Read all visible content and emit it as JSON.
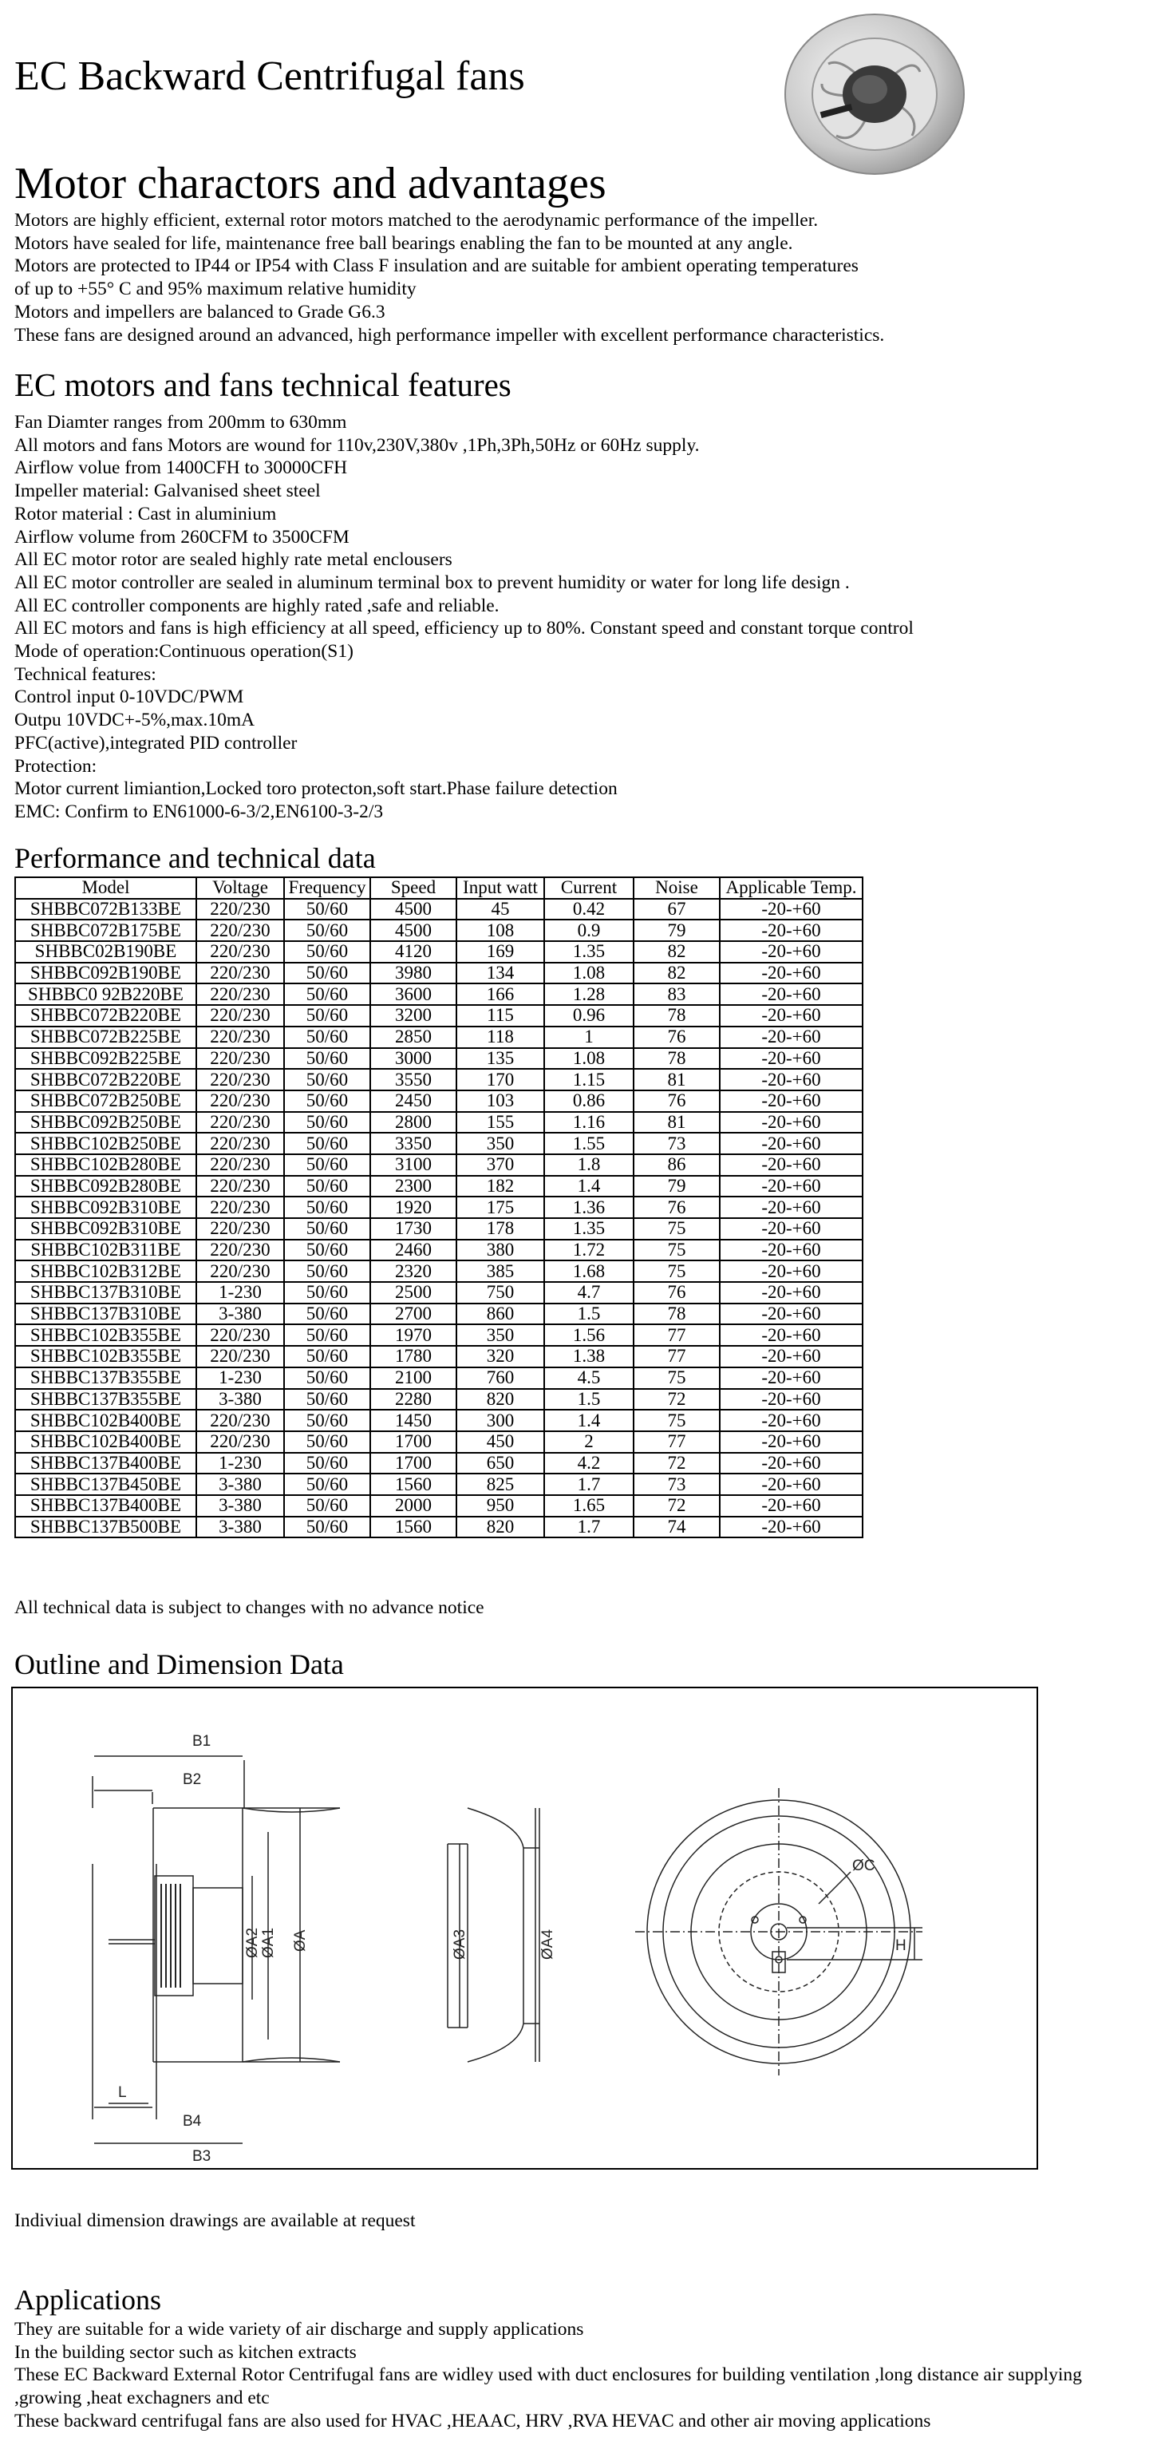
{
  "title": "EC  Backward Centrifugal fans",
  "motor_section": {
    "heading": "Motor charactors and advantages",
    "lines": [
      " Motors are highly efficient, external rotor motors matched to the aerodynamic performance of the impeller.",
      "Motors have sealed for life, maintenance free ball bearings enabling the fan to be mounted at any angle.",
      "Motors are protected to IP44 or IP54 with Class F insulation and are suitable for ambient operating temperatures",
      "of up to +55° C and 95% maximum relative humidity",
      "Motors and impellers are balanced to Grade G6.3",
      "These fans are designed around an advanced, high performance impeller with excellent performance characteristics."
    ]
  },
  "features_section": {
    "heading": "EC motors and fans technical features",
    "lines": [
      "Fan Diamter ranges from  200mm to 630mm",
      "All motors and fans Motors are wound for 110v,230V,380v ,1Ph,3Ph,50Hz or 60Hz supply.",
      "Airflow volue from 1400CFH to 30000CFH",
      "Impeller material: Galvanised sheet steel",
      "Rotor material : Cast in aluminium",
      "Airflow volume from 260CFM to 3500CFM",
      "All EC motor rotor are sealed highly rate metal enclousers",
      "All EC motor controller are sealed in aluminum terminal box to prevent humidity or water for long life design .",
      "All EC controller components are highly rated ,safe and reliable.",
      "All EC motors and fans is high efficiency at all speed, efficiency up to 80%. Constant speed and constant torque control",
      "Mode of operation:Continuous operation(S1)",
      "Technical features:",
      "Control input 0-10VDC/PWM",
      "Outpu 10VDC+-5%,max.10mA",
      "PFC(active),integrated PID controller",
      "Protection:",
      "Motor current limiantion,Locked toro protecton,soft start.Phase failure detection",
      "EMC: Confirm to EN61000-6-3/2,EN6100-3-2/3"
    ]
  },
  "performance": {
    "heading": "Performance and technical data",
    "columns": [
      "Model",
      "Voltage",
      "Frequency",
      "Speed",
      "Input watt",
      "Current",
      "Noise",
      "Applicable Temp."
    ],
    "rows": [
      [
        "SHBBC072B133BE",
        "220/230",
        "50/60",
        "4500",
        "45",
        "0.42",
        "67",
        "-20-+60"
      ],
      [
        "SHBBC072B175BE",
        "220/230",
        "50/60",
        "4500",
        "108",
        "0.9",
        "79",
        "-20-+60"
      ],
      [
        "SHBBC02B190BE",
        "220/230",
        "50/60",
        "4120",
        "169",
        "1.35",
        "82",
        "-20-+60"
      ],
      [
        "SHBBC092B190BE",
        "220/230",
        "50/60",
        "3980",
        "134",
        "1.08",
        "82",
        "-20-+60"
      ],
      [
        "SHBBC0 92B220BE",
        "220/230",
        "50/60",
        "3600",
        "166",
        "1.28",
        "83",
        "-20-+60"
      ],
      [
        "SHBBC072B220BE",
        "220/230",
        "50/60",
        "3200",
        "115",
        "0.96",
        "78",
        "-20-+60"
      ],
      [
        "SHBBC072B225BE",
        "220/230",
        "50/60",
        "2850",
        "118",
        "1",
        "76",
        "-20-+60"
      ],
      [
        "SHBBC092B225BE",
        "220/230",
        "50/60",
        "3000",
        "135",
        "1.08",
        "78",
        "-20-+60"
      ],
      [
        "SHBBC072B220BE",
        "220/230",
        "50/60",
        "3550",
        "170",
        "1.15",
        "81",
        "-20-+60"
      ],
      [
        "SHBBC072B250BE",
        "220/230",
        "50/60",
        "2450",
        "103",
        "0.86",
        "76",
        "-20-+60"
      ],
      [
        "SHBBC092B250BE",
        "220/230",
        "50/60",
        "2800",
        "155",
        "1.16",
        "81",
        "-20-+60"
      ],
      [
        "SHBBC102B250BE",
        "220/230",
        "50/60",
        "3350",
        "350",
        "1.55",
        "73",
        "-20-+60"
      ],
      [
        "SHBBC102B280BE",
        "220/230",
        "50/60",
        "3100",
        "370",
        "1.8",
        "86",
        "-20-+60"
      ],
      [
        "SHBBC092B280BE",
        "220/230",
        "50/60",
        "2300",
        "182",
        "1.4",
        "79",
        "-20-+60"
      ],
      [
        "SHBBC092B310BE",
        "220/230",
        "50/60",
        "1920",
        "175",
        "1.36",
        "76",
        "-20-+60"
      ],
      [
        "SHBBC092B310BE",
        "220/230",
        "50/60",
        "1730",
        "178",
        "1.35",
        "75",
        "-20-+60"
      ],
      [
        "SHBBC102B311BE",
        "220/230",
        "50/60",
        "2460",
        "380",
        "1.72",
        "75",
        "-20-+60"
      ],
      [
        "SHBBC102B312BE",
        "220/230",
        "50/60",
        "2320",
        "385",
        "1.68",
        "75",
        "-20-+60"
      ],
      [
        "SHBBC137B310BE",
        "1-230",
        "50/60",
        "2500",
        "750",
        "4.7",
        "76",
        "-20-+60"
      ],
      [
        "SHBBC137B310BE",
        "3-380",
        "50/60",
        "2700",
        "860",
        "1.5",
        "78",
        "-20-+60"
      ],
      [
        "SHBBC102B355BE",
        "220/230",
        "50/60",
        "1970",
        "350",
        "1.56",
        "77",
        "-20-+60"
      ],
      [
        "SHBBC102B355BE",
        "220/230",
        "50/60",
        "1780",
        "320",
        "1.38",
        "77",
        "-20-+60"
      ],
      [
        "SHBBC137B355BE",
        "1-230",
        "50/60",
        "2100",
        "760",
        "4.5",
        "75",
        "-20-+60"
      ],
      [
        "SHBBC137B355BE",
        "3-380",
        "50/60",
        "2280",
        "820",
        "1.5",
        "72",
        "-20-+60"
      ],
      [
        "SHBBC102B400BE",
        "220/230",
        "50/60",
        "1450",
        "300",
        "1.4",
        "75",
        "-20-+60"
      ],
      [
        "SHBBC102B400BE",
        "220/230",
        "50/60",
        "1700",
        "450",
        "2",
        "77",
        "-20-+60"
      ],
      [
        "SHBBC137B400BE",
        "1-230",
        "50/60",
        "1700",
        "650",
        "4.2",
        "72",
        "-20-+60"
      ],
      [
        "SHBBC137B450BE",
        "3-380",
        "50/60",
        "1560",
        "825",
        "1.7",
        "73",
        "-20-+60"
      ],
      [
        "SHBBC137B400BE",
        "3-380",
        "50/60",
        "2000",
        "950",
        "1.65",
        "72",
        "-20-+60"
      ],
      [
        "SHBBC137B500BE",
        "3-380",
        "50/60",
        "1560",
        "820",
        "1.7",
        "74",
        "-20-+60"
      ]
    ],
    "note": "All technical data is subject to changes with no advance notice"
  },
  "outline": {
    "heading": "Outline and Dimension Data",
    "dim_labels": {
      "b1": "B1",
      "b2": "B2",
      "b3": "B3",
      "b4": "B4",
      "l": "L",
      "a": "ØA",
      "a1": "ØA1",
      "a2": "ØA2",
      "a3": "ØA3",
      "a4": "ØA4",
      "c": "ØC",
      "h": "H"
    },
    "note": "Indiviual dimension drawings are available at request"
  },
  "applications": {
    "heading": "Applications",
    "lines": [
      "They are suitable for  a wide variety of air discharge and supply applications",
      " In the building sector such as kitchen extracts",
      "These EC Backward External Rotor Centrifugal fans are widley used with duct enclosures for building ventilation ,long distance air supplying",
      ",growing ,heat exchagners and etc",
      "These backward centrifugal fans are also used for HVAC ,HEAAC, HRV ,RVA HEVAC and other air moving applications"
    ]
  }
}
